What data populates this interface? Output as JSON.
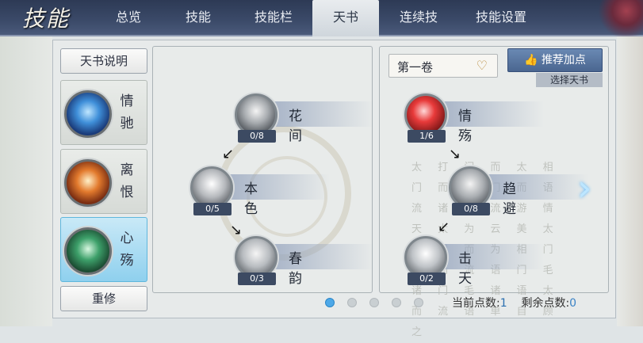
{
  "logo": "技能",
  "tabs": [
    {
      "label": "总览",
      "active": false
    },
    {
      "label": "技能",
      "active": false
    },
    {
      "label": "技能栏",
      "active": false
    },
    {
      "label": "天书",
      "active": true
    },
    {
      "label": "连续技",
      "active": false
    },
    {
      "label": "技能设置",
      "active": false
    }
  ],
  "left_panel": {
    "explain_button": "天书说明",
    "schools": [
      {
        "name": "情驰",
        "active": false
      },
      {
        "name": "离恨",
        "active": false
      },
      {
        "name": "心殇",
        "active": true
      }
    ],
    "reset_button": "重修"
  },
  "left_tree": {
    "skills": [
      {
        "name": "花间",
        "count": "0/8"
      },
      {
        "name": "本色",
        "count": "0/5"
      },
      {
        "name": "春韵",
        "count": "0/3"
      }
    ]
  },
  "right_tree": {
    "volume_label": "第一卷",
    "recommend_button": "推荐加点",
    "choose_book": "选择天书",
    "skills": [
      {
        "name": "情殇",
        "count": "1/6"
      },
      {
        "name": "趋避",
        "count": "0/8"
      },
      {
        "name": "击天",
        "count": "0/2"
      }
    ],
    "poem_text": "太 打 门 而 太 相 门 而 语 门 而 语 流 诸 门 流 游 情 天 太 为 云 美 太 门 门 而 为 相 门 门 而 流 语 门 毛 诸 门 毛 诸 语 太 而 流 语 单 自 顾 之"
  },
  "pager": {
    "count": 5,
    "active": 1
  },
  "footer": {
    "current_label": "当前点数:",
    "current_value": "1",
    "remaining_label": "剩余点数:",
    "remaining_value": "0"
  },
  "colors": {
    "tab_active": "#e9ecef",
    "accent_blue": "#4da8e8",
    "plate": "#96a5be"
  }
}
